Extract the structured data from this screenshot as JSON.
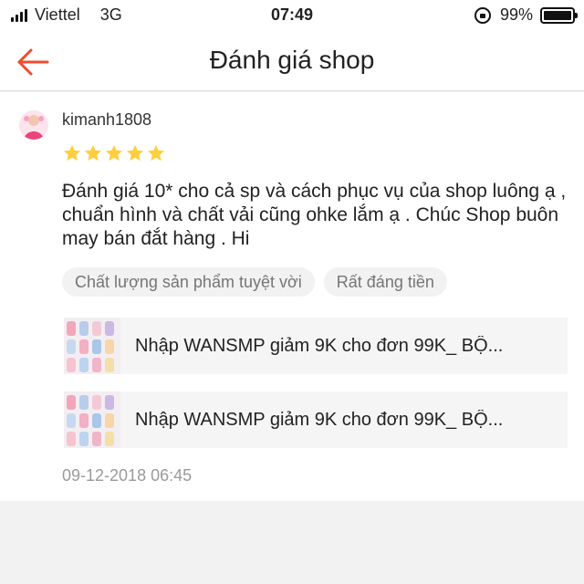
{
  "status_bar": {
    "carrier": "Viettel",
    "network": "3G",
    "time": "07:49",
    "battery": "99%"
  },
  "header": {
    "title": "Đánh giá shop"
  },
  "review": {
    "username": "kimanh1808",
    "rating": 5,
    "max_rating": 5,
    "text": "Đánh giá 10* cho cả sp và cách phục vụ của shop luông ạ , chuẩn hình và chất vải cũng ohke lắm ạ . Chúc Shop buôn may bán đắt hàng . Hi",
    "tags": [
      "Chất lượng sản phẩm tuyệt vời",
      "Rất đáng tiền"
    ],
    "products": [
      {
        "name": "Nhập WANSMP giảm 9K cho đơn 99K_ BỘ..."
      },
      {
        "name": "Nhập WANSMP giảm 9K cho đơn 99K_ BỘ..."
      }
    ],
    "date": "09-12-2018 06:45"
  },
  "colors": {
    "accent": "#ee4d2d",
    "star": "#ffce3d"
  }
}
